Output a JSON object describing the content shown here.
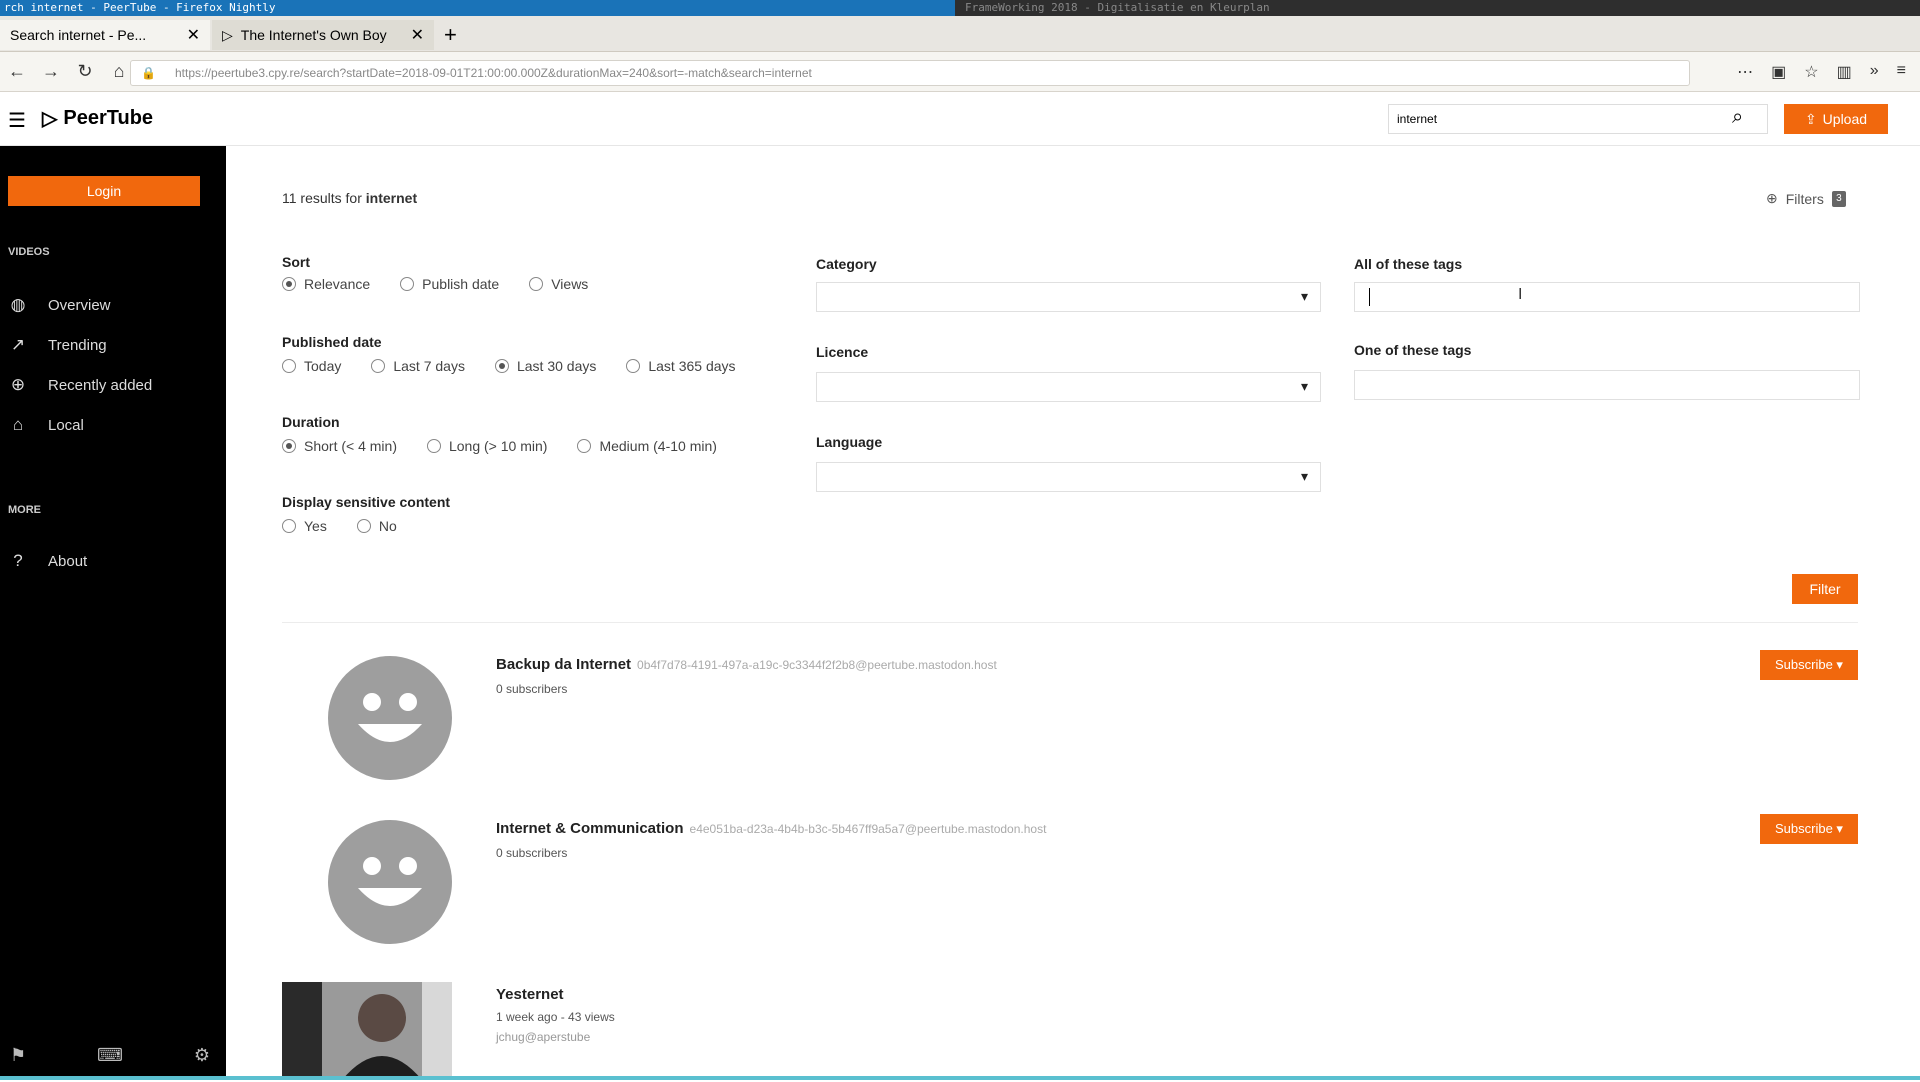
{
  "os_bar": {
    "left_title": "rch internet - PeerTube - Firefox Nightly",
    "right_title": "FrameWorking 2018 - Digitalisatie en Kleurplan"
  },
  "browser": {
    "tabs": [
      {
        "label": "Search internet - Pe..."
      },
      {
        "label": "The Internet's Own Boy"
      }
    ],
    "new_tab": "+",
    "url": "https://peertube3.cpy.re/search?startDate=2018-09-01T21:00:00.000Z&durationMax=240&sort=-match&search=internet"
  },
  "header": {
    "logo": "PeerTube",
    "search_value": "internet",
    "upload_label": "Upload"
  },
  "sidebar": {
    "login_label": "Login",
    "videos_section": "VIDEOS",
    "items": [
      {
        "label": "Overview"
      },
      {
        "label": "Trending"
      },
      {
        "label": "Recently added"
      },
      {
        "label": "Local"
      }
    ],
    "more_section": "MORE",
    "about_label": "About"
  },
  "search": {
    "results_prefix": "11 results for ",
    "query": "internet",
    "filters_label": "Filters",
    "filters_count": "3",
    "filter_button": "Filter"
  },
  "filters": {
    "sort": {
      "label": "Sort",
      "options": [
        "Relevance",
        "Publish date",
        "Views"
      ],
      "selected": "Relevance"
    },
    "published": {
      "label": "Published date",
      "options": [
        "Today",
        "Last 7 days",
        "Last 30 days",
        "Last 365 days"
      ],
      "selected": "Last 30 days"
    },
    "duration": {
      "label": "Duration",
      "options": [
        "Short (< 4 min)",
        "Long (> 10 min)",
        "Medium (4-10 min)"
      ],
      "selected": "Short (< 4 min)"
    },
    "sensitive": {
      "label": "Display sensitive content",
      "options": [
        "Yes",
        "No"
      ],
      "selected": ""
    },
    "category_label": "Category",
    "licence_label": "Licence",
    "language_label": "Language",
    "all_tags_label": "All of these tags",
    "one_tags_label": "One of these tags"
  },
  "channels": [
    {
      "name": "Backup da Internet",
      "handle": "0b4f7d78-4191-497a-a19c-9c3344f2f2b8@peertube.mastodon.host",
      "subscribers": "0 subscribers",
      "subscribe_label": "Subscribe ▾"
    },
    {
      "name": "Internet & Communication",
      "handle": "e4e051ba-d23a-4b4b-b3c-5b467ff9a5a7@peertube.mastodon.host",
      "subscribers": "0 subscribers",
      "subscribe_label": "Subscribe ▾"
    }
  ],
  "video": {
    "title": "Yesternet",
    "meta": "1 week ago - 43 views",
    "author": "jchug@aperstube"
  },
  "colors": {
    "accent": "#f1680d",
    "sidebar_bg": "#000000"
  }
}
